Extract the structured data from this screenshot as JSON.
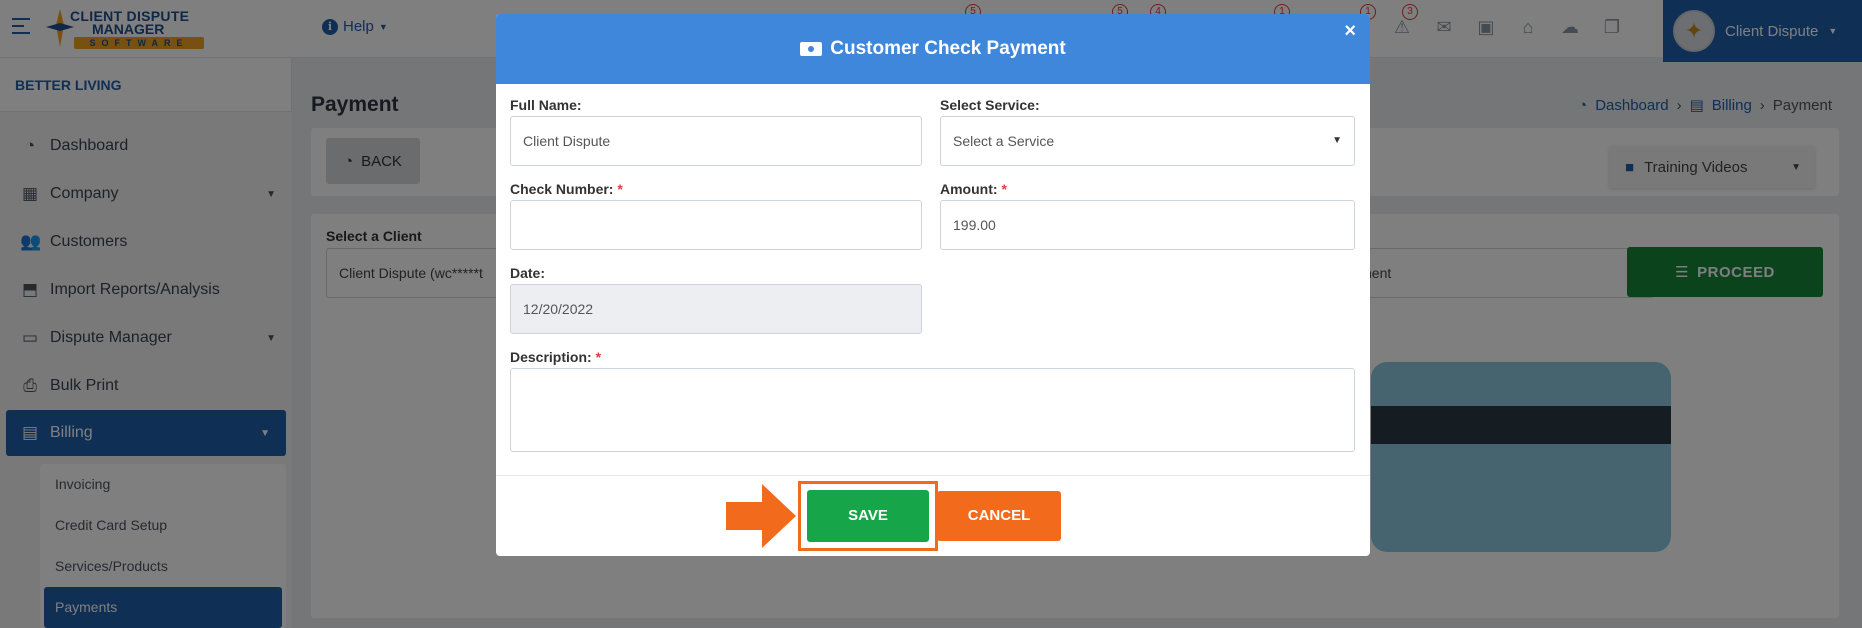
{
  "topbar": {
    "help_label": "Help",
    "badges": [
      "5",
      "5",
      "4",
      "1",
      "1",
      "3"
    ],
    "user_name": "Client Dispute"
  },
  "logo": {
    "line1": "CLIENT DISPUTE",
    "line2": "MANAGER",
    "line3": "SOFTWARE"
  },
  "sidebar": {
    "brand": "BETTER LIVING",
    "items": [
      {
        "label": "Dashboard"
      },
      {
        "label": "Company"
      },
      {
        "label": "Customers"
      },
      {
        "label": "Import Reports/Analysis"
      },
      {
        "label": "Dispute Manager"
      },
      {
        "label": "Bulk Print"
      },
      {
        "label": "Billing"
      }
    ],
    "billing_sub": [
      {
        "label": "Invoicing"
      },
      {
        "label": "Credit Card Setup"
      },
      {
        "label": "Services/Products"
      },
      {
        "label": "Payments"
      }
    ]
  },
  "main": {
    "page_title": "Payment",
    "breadcrumb": [
      "Dashboard",
      "Billing",
      "Payment"
    ],
    "back_label": "BACK",
    "training_label": "Training Videos",
    "select_client_label": "Select a Client",
    "client_value": "Client Dispute (wc*****t",
    "payment_method_value": "nent",
    "proceed_label": "PROCEED"
  },
  "modal": {
    "title": "Customer Check Payment",
    "close": "×",
    "full_name_label": "Full Name:",
    "full_name_value": "Client Dispute",
    "select_service_label": "Select Service:",
    "select_service_value": "Select a Service",
    "check_number_label": "Check Number:",
    "check_number_value": "",
    "amount_label": "Amount:",
    "amount_value": "199.00",
    "date_label": "Date:",
    "date_value": "12/20/2022",
    "description_label": "Description:",
    "description_value": "",
    "required_mark": "*",
    "save_label": "SAVE",
    "cancel_label": "CANCEL"
  },
  "colors": {
    "primary_blue": "#1f5fa8",
    "modal_header": "#3f87db",
    "save_green": "#17a54a",
    "cancel_orange": "#f26a1b",
    "proceed_green": "#17873b"
  }
}
